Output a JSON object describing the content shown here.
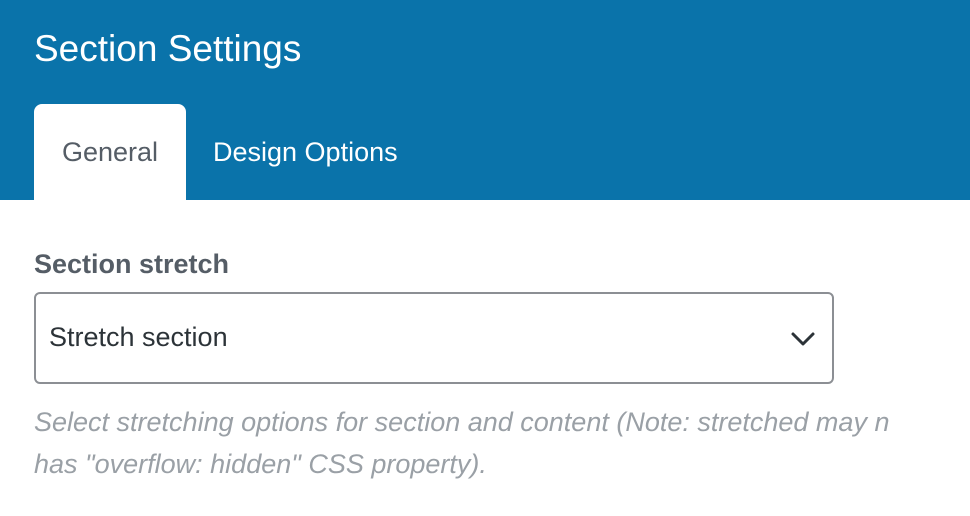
{
  "header": {
    "title": "Section Settings",
    "tabs": [
      {
        "label": "General",
        "active": true
      },
      {
        "label": "Design Options",
        "active": false
      }
    ]
  },
  "section_stretch": {
    "label": "Section stretch",
    "selected_value": "Stretch section",
    "help_line_1": "Select stretching options for section and content (Note: stretched may n",
    "help_line_2": "has \"overflow: hidden\" CSS property)."
  },
  "icons": {
    "dropdown": "chevron-down-icon"
  },
  "colors": {
    "header_bg": "#0a73aa",
    "tab_active_text": "#555d66",
    "help_text": "#9aa0a6"
  }
}
